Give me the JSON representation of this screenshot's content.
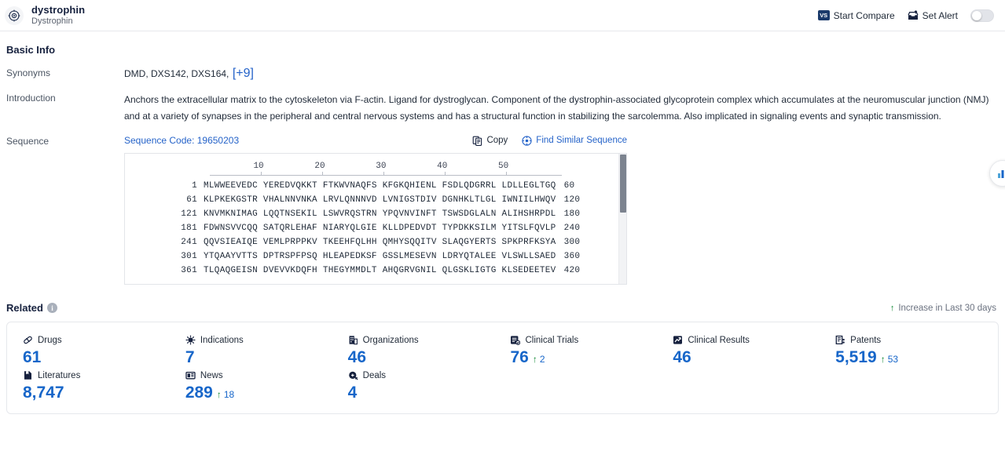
{
  "header": {
    "logo_icon": "target-crosshair-icon",
    "title": "dystrophin",
    "subtitle": "Dystrophin",
    "start_compare_label": "Start Compare",
    "start_compare_icon": "vs-badge-icon",
    "set_alert_label": "Set Alert",
    "set_alert_icon": "alert-inbox-icon",
    "alert_toggle_state": "off"
  },
  "basic_info": {
    "section_title": "Basic Info",
    "synonyms_label": "Synonyms",
    "synonyms_value": "DMD, DXS142, DXS164,",
    "synonyms_more": "[+9]",
    "introduction_label": "Introduction",
    "introduction_text": "Anchors the extracellular matrix to the cytoskeleton via F-actin. Ligand for dystroglycan. Component of the dystrophin-associated glycoprotein complex which accumulates at the neuromuscular junction (NMJ) and at a variety of synapses in the peripheral and central nervous systems and has a structural function in stabilizing the sarcolemma. Also implicated in signaling events and synaptic transmission.",
    "sequence_label": "Sequence",
    "sequence_code": "Sequence Code: 19650203",
    "copy_label": "Copy",
    "copy_icon": "copy-icon",
    "find_similar_label": "Find Similar Sequence",
    "find_similar_icon": "find-similar-icon"
  },
  "sequence_viewer": {
    "ruler_ticks": [
      10,
      20,
      30,
      40,
      50
    ],
    "rows": [
      {
        "start": "1",
        "chunks": [
          "MLWWEEVEDC",
          "YEREDVQKKT",
          "FTKWVNAQFS",
          "KFGKQHIENL",
          "FSDLQDGRRL",
          "LDLLEGLTGQ"
        ],
        "end": "60"
      },
      {
        "start": "61",
        "chunks": [
          "KLPKEKGSTR",
          "VHALNNVNKA",
          "LRVLQNNNVD",
          "LVNIGSTDIV",
          "DGNHKLTLGL",
          "IWNIILHWQV"
        ],
        "end": "120"
      },
      {
        "start": "121",
        "chunks": [
          "KNVMKNIMAG",
          "LQQTNSEKIL",
          "LSWVRQSTRN",
          "YPQVNVINFT",
          "TSWSDGLALN",
          "ALIHSHRPDL"
        ],
        "end": "180"
      },
      {
        "start": "181",
        "chunks": [
          "FDWNSVVCQQ",
          "SATQRLEHAF",
          "NIARYQLGIE",
          "KLLDPEDVDT",
          "TYPDKKSILM",
          "YITSLFQVLP"
        ],
        "end": "240"
      },
      {
        "start": "241",
        "chunks": [
          "QQVSIEAIQE",
          "VEMLPRPPKV",
          "TKEEHFQLHH",
          "QMHYSQQITV",
          "SLAQGYERTS",
          "SPKPRFKSYA"
        ],
        "end": "300"
      },
      {
        "start": "301",
        "chunks": [
          "YTQAAYVTTS",
          "DPTRSPFPSQ",
          "HLEAPEDKSF",
          "GSSLMESEVN",
          "LDRYQTALEE",
          "VLSWLLSAED"
        ],
        "end": "360"
      },
      {
        "start": "361",
        "chunks": [
          "TLQAQGEISN",
          "DVEVVKDQFH",
          "THEGYMMDLT",
          "AHQGRVGNIL",
          "QLGSKLIGTG",
          "KLSEDEETEV"
        ],
        "end": "420"
      }
    ]
  },
  "floating_button": {
    "icon": "bar-chart-icon"
  },
  "related": {
    "title": "Related",
    "info_icon": "info-icon",
    "legend_text": "Increase in Last 30 days",
    "legend_icon": "up-arrow-icon",
    "cards": [
      {
        "label": "Drugs",
        "icon": "pill-icon",
        "value": "61",
        "delta": null
      },
      {
        "label": "Indications",
        "icon": "virus-icon",
        "value": "7",
        "delta": null
      },
      {
        "label": "Organizations",
        "icon": "building-icon",
        "value": "46",
        "delta": null
      },
      {
        "label": "Clinical Trials",
        "icon": "clinical-trial-icon",
        "value": "76",
        "delta": "2"
      },
      {
        "label": "Clinical Results",
        "icon": "clinical-result-icon",
        "value": "46",
        "delta": null
      },
      {
        "label": "Patents",
        "icon": "patent-icon",
        "value": "5,519",
        "delta": "53"
      },
      {
        "label": "Literatures",
        "icon": "book-icon",
        "value": "8,747",
        "delta": null
      },
      {
        "label": "News",
        "icon": "news-icon",
        "value": "289",
        "delta": "18"
      },
      {
        "label": "Deals",
        "icon": "deal-icon",
        "value": "4",
        "delta": null
      }
    ]
  },
  "colors": {
    "accent_blue": "#1766c9",
    "link_blue": "#2563c9",
    "increase_green": "#138a36",
    "title_navy": "#16213e"
  }
}
